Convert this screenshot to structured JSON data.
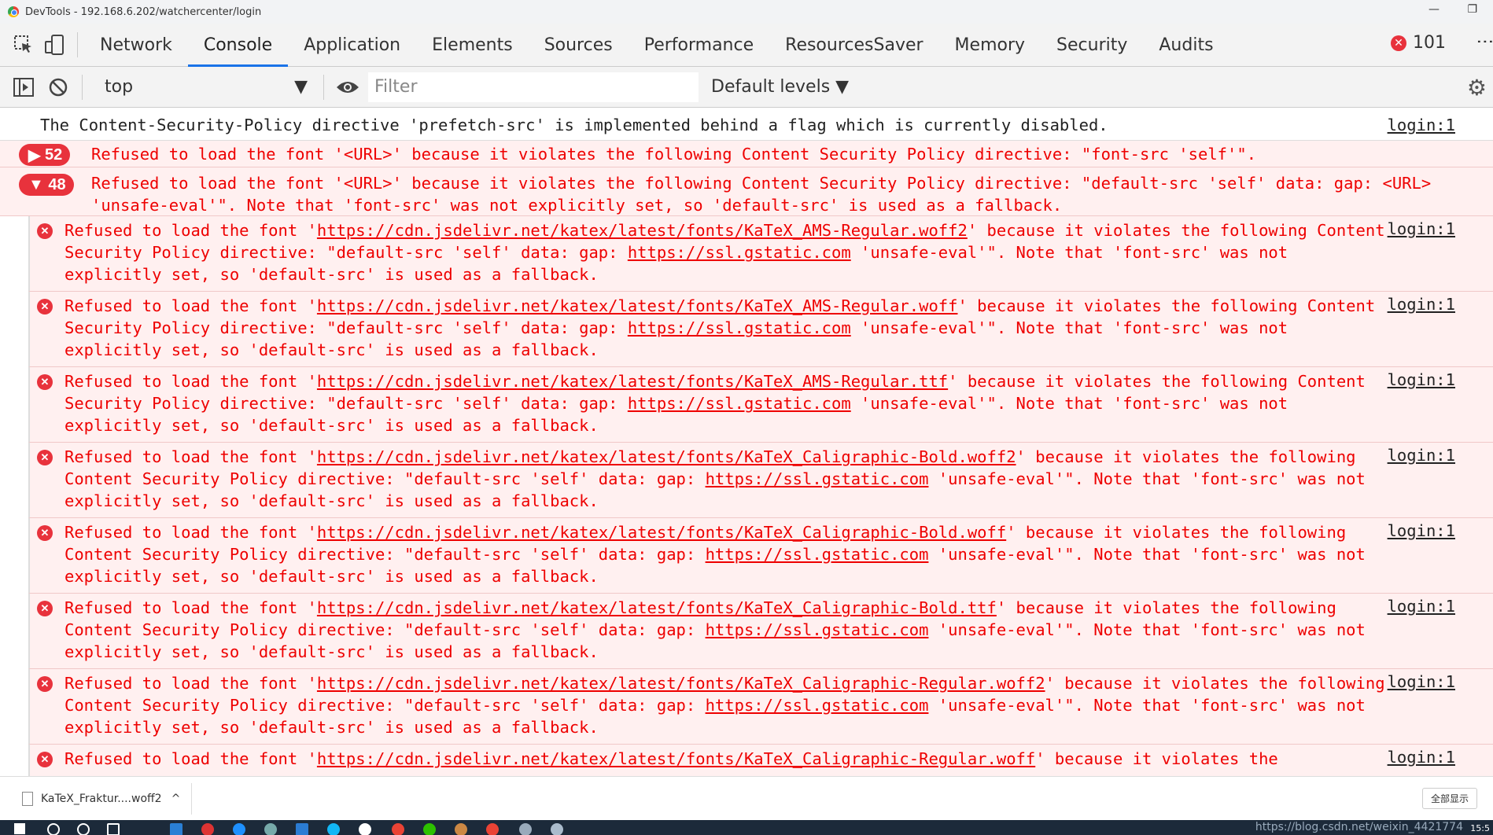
{
  "window": {
    "title": "DevTools - 192.168.6.202/watchercenter/login",
    "minimize": "—",
    "maximize": "❐"
  },
  "tabs": [
    "Network",
    "Console",
    "Application",
    "Elements",
    "Sources",
    "Performance",
    "ResourcesSaver",
    "Memory",
    "Security",
    "Audits"
  ],
  "active_tab": "Console",
  "error_count": "101",
  "toolbar": {
    "context": "top",
    "filter_placeholder": "Filter",
    "levels": "Default levels ▼"
  },
  "messages": {
    "info": {
      "text": "The Content-Security-Policy directive 'prefetch-src' is implemented behind a flag which is currently disabled.",
      "source": "login:1"
    },
    "group1": {
      "count": "52",
      "arrow": "▶",
      "text": "Refused to load the font '<URL>' because it violates the following Content Security Policy directive: \"font-src 'self'\"."
    },
    "group2": {
      "count": "48",
      "arrow": "▼",
      "text": "Refused to load the font '<URL>' because it violates the following Content Security Policy directive: \"default-src 'self' data: gap: <URL> 'unsafe-eval'\". Note that 'font-src' was not explicitly set, so 'default-src' is used as a fallback."
    },
    "rows": [
      {
        "pre": "Refused to load the font '",
        "url": "https://cdn.jsdelivr.net/katex/latest/fonts/KaTeX_AMS-Regular.woff2",
        "mid": "' because it violates the following Content Security Policy directive: \"default-src 'self' data: gap: ",
        "gs": "https://ssl.gstatic.com",
        "post": " 'unsafe-eval'\". Note that 'font-src' was not explicitly set, so 'default-src' is used as a fallback.",
        "source": "login:1"
      },
      {
        "pre": "Refused to load the font '",
        "url": "https://cdn.jsdelivr.net/katex/latest/fonts/KaTeX_AMS-Regular.woff",
        "mid": "' because it violates the following Content Security Policy directive: \"default-src 'self' data: gap: ",
        "gs": "https://ssl.gstatic.com",
        "post": " 'unsafe-eval'\". Note that 'font-src' was not explicitly set, so 'default-src' is used as a fallback.",
        "source": "login:1"
      },
      {
        "pre": "Refused to load the font '",
        "url": "https://cdn.jsdelivr.net/katex/latest/fonts/KaTeX_AMS-Regular.ttf",
        "mid": "' because it violates the following Content Security Policy directive: \"default-src 'self' data: gap: ",
        "gs": "https://ssl.gstatic.com",
        "post": " 'unsafe-eval'\". Note that 'font-src' was not explicitly set, so 'default-src' is used as a fallback.",
        "source": "login:1"
      },
      {
        "pre": "Refused to load the font '",
        "url": "https://cdn.jsdelivr.net/katex/latest/fonts/KaTeX_Caligraphic-Bold.woff2",
        "mid": "' because it violates the following Content Security Policy directive: \"default-src 'self' data: gap: ",
        "gs": "https://ssl.gstatic.com",
        "post": " 'unsafe-eval'\". Note that 'font-src' was not explicitly set, so 'default-src' is used as a fallback.",
        "source": "login:1"
      },
      {
        "pre": "Refused to load the font '",
        "url": "https://cdn.jsdelivr.net/katex/latest/fonts/KaTeX_Caligraphic-Bold.woff",
        "mid": "' because it violates the following Content Security Policy directive: \"default-src 'self' data: gap: ",
        "gs": "https://ssl.gstatic.com",
        "post": " 'unsafe-eval'\". Note that 'font-src' was not explicitly set, so 'default-src' is used as a fallback.",
        "source": "login:1"
      },
      {
        "pre": "Refused to load the font '",
        "url": "https://cdn.jsdelivr.net/katex/latest/fonts/KaTeX_Caligraphic-Bold.ttf",
        "mid": "' because it violates the following Content Security Policy directive: \"default-src 'self' data: gap: ",
        "gs": "https://ssl.gstatic.com",
        "post": " 'unsafe-eval'\". Note that 'font-src' was not explicitly set, so 'default-src' is used as a fallback.",
        "source": "login:1"
      },
      {
        "pre": "Refused to load the font '",
        "url": "https://cdn.jsdelivr.net/katex/latest/fonts/KaTeX_Caligraphic-Regular.woff2",
        "mid": "' because it violates the following Content Security Policy directive: \"default-src 'self' data: gap: ",
        "gs": "https://ssl.gstatic.com",
        "post": " 'unsafe-eval'\". Note that 'font-src' was not explicitly set, so 'default-src' is used as a fallback.",
        "source": "login:1"
      },
      {
        "pre": "Refused to load the font '",
        "url": "https://cdn.jsdelivr.net/katex/latest/fonts/KaTeX_Caligraphic-Regular.woff",
        "mid": "' because it violates the",
        "gs": "",
        "post": "",
        "source": "login:1"
      }
    ]
  },
  "download": {
    "file": "KaTeX_Fraktur....woff2",
    "chevron": "^",
    "show_all": "全部显示"
  },
  "taskbar": {
    "watermark": "https://blog.csdn.net/weixin_4421774",
    "clock": "15:5"
  },
  "colors": {
    "error_text": "#e00000",
    "error_bg": "#fff0f0",
    "accent": "#1a73e8",
    "badge": "#e8323c"
  }
}
